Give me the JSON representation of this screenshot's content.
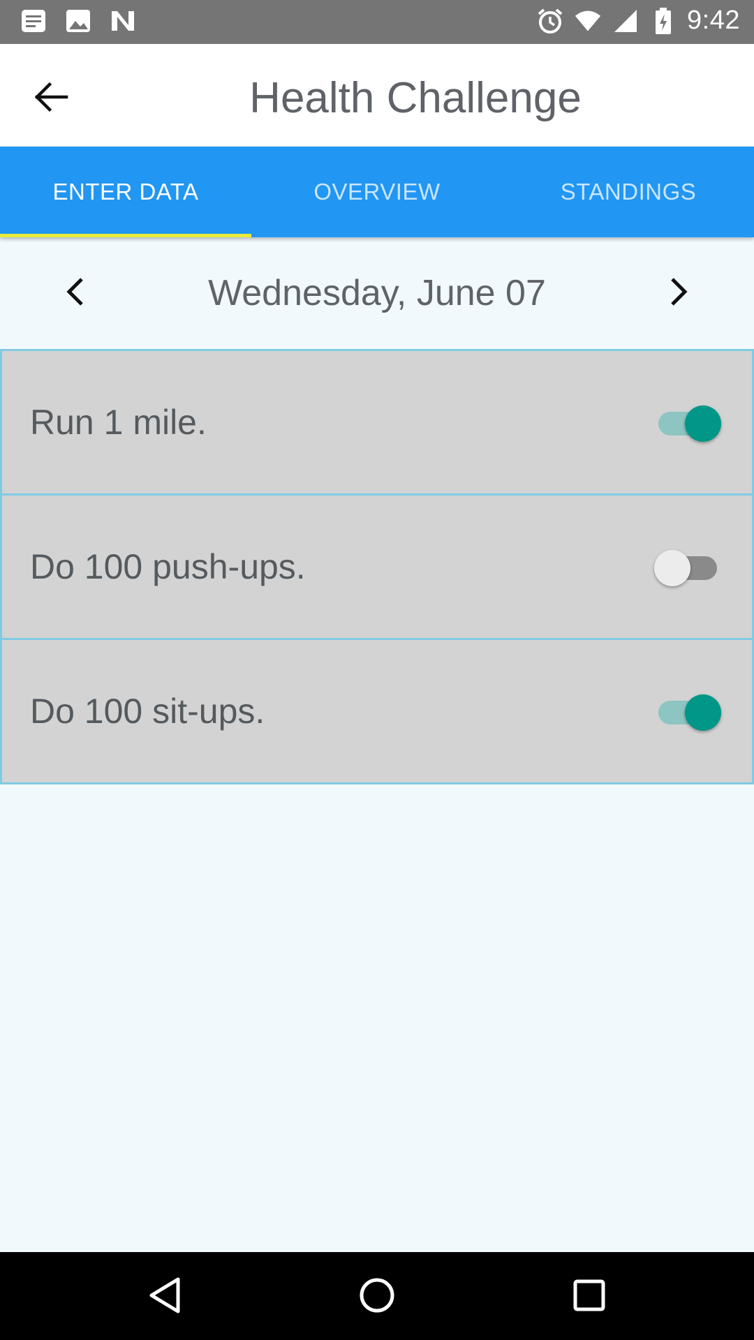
{
  "status_bar": {
    "time": "9:42",
    "left_icons": [
      "notes-icon",
      "image-icon",
      "n-app-icon"
    ],
    "right_icons": [
      "alarm-icon",
      "wifi-icon",
      "signal-icon",
      "battery-icon"
    ]
  },
  "app_bar": {
    "title": "Health Challenge",
    "back_icon": "arrow-back-icon"
  },
  "tabs": [
    {
      "label": "ENTER DATA",
      "active": true
    },
    {
      "label": "OVERVIEW",
      "active": false
    },
    {
      "label": "STANDINGS",
      "active": false
    }
  ],
  "date_nav": {
    "label": "Wednesday, June 07",
    "prev_icon": "chevron-left-icon",
    "next_icon": "chevron-right-icon"
  },
  "tasks": [
    {
      "label": "Run 1 mile.",
      "completed": true
    },
    {
      "label": "Do 100 push-ups.",
      "completed": false
    },
    {
      "label": "Do 100 sit-ups.",
      "completed": true
    }
  ],
  "colors": {
    "tab_bar": "#2196f3",
    "tab_indicator": "#e8eb39",
    "switch_on": "#009688",
    "background": "#f2f9fd"
  },
  "nav_bar": {
    "icons": [
      "back-triangle-icon",
      "home-circle-icon",
      "recents-square-icon"
    ]
  }
}
